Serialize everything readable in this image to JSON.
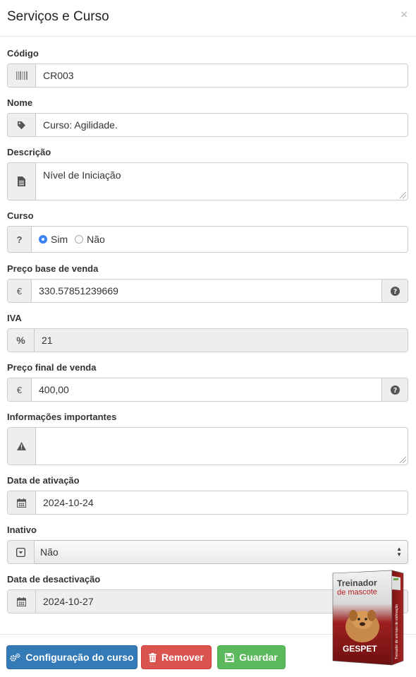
{
  "modal": {
    "title": "Serviços e Curso",
    "close": "×"
  },
  "fields": {
    "codigo": {
      "label": "Código",
      "value": "CR003",
      "icon": "barcode-icon"
    },
    "nome": {
      "label": "Nome",
      "value": "Curso: Agilidade.",
      "icon": "tag-icon"
    },
    "descricao": {
      "label": "Descrição",
      "value": "Nível de Iniciação",
      "icon": "file-icon"
    },
    "curso": {
      "label": "Curso",
      "icon": "question-icon",
      "option_yes": "Sim",
      "option_no": "Não",
      "selected": "Sim"
    },
    "preco_base": {
      "label": "Preço base de venda",
      "value": "330.57851239669",
      "currency": "€",
      "help_icon": "question-circle-icon"
    },
    "iva": {
      "label": "IVA",
      "value": "21",
      "symbol": "%"
    },
    "preco_final": {
      "label": "Preço final de venda",
      "value": "400,00",
      "currency": "€",
      "help_icon": "question-circle-icon"
    },
    "informacoes": {
      "label": "Informações importantes",
      "value": "",
      "icon": "warning-icon"
    },
    "data_ativacao": {
      "label": "Data de ativação",
      "value": "2024-10-24",
      "icon": "calendar-icon"
    },
    "inativo": {
      "label": "Inativo",
      "value": "Não",
      "icon": "dropdown-icon"
    },
    "data_desactivacao": {
      "label": "Data de desactivação",
      "value": "2024-10-27",
      "icon": "calendar-icon"
    }
  },
  "buttons": {
    "config": "Configuração do curso",
    "remove": "Remover",
    "save": "Guardar"
  },
  "product_box": {
    "title_line1": "Treinador",
    "title_line2": "de mascote",
    "brand": "GESPET",
    "side_text": "Treinador de animais de estimação"
  },
  "colors": {
    "primary": "#337ab7",
    "danger": "#d9534f",
    "success": "#5cb85c",
    "box_red": "#8b1a1a"
  }
}
